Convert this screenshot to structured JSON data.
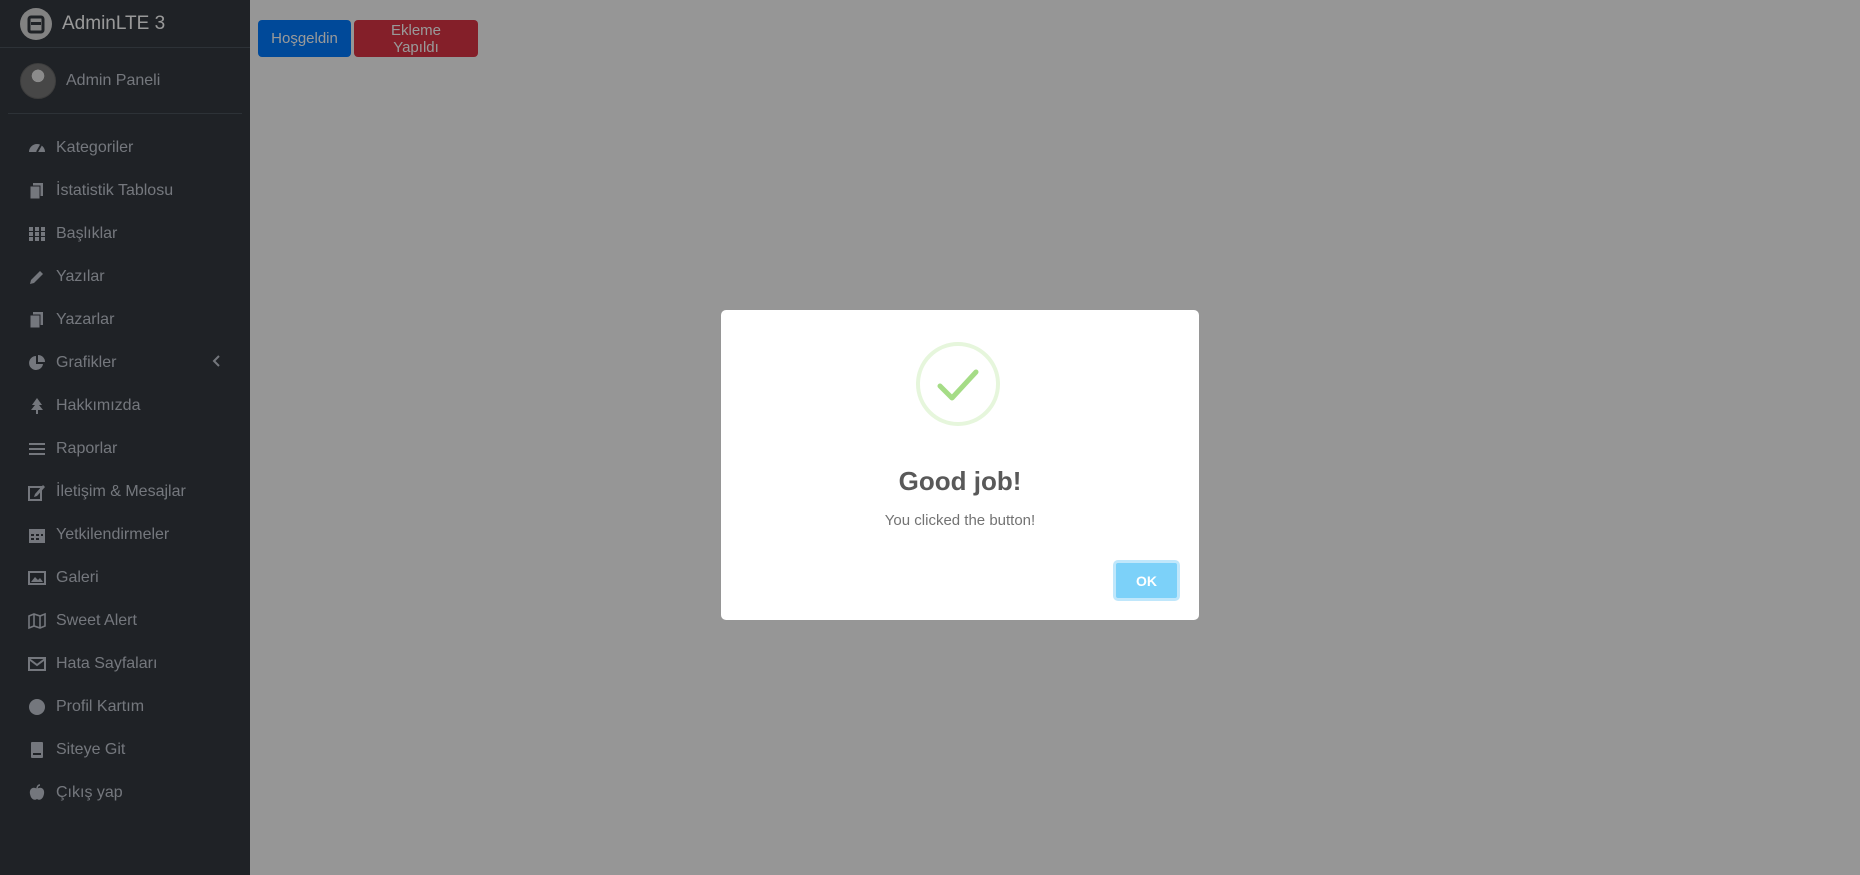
{
  "brand": {
    "title": "AdminLTE 3"
  },
  "user_panel": {
    "name": "Admin Paneli"
  },
  "sidebar": {
    "items": [
      {
        "label": "Kategoriler",
        "icon": "tachometer-icon"
      },
      {
        "label": "İstatistik Tablosu",
        "icon": "copy-icon"
      },
      {
        "label": "Başlıklar",
        "icon": "grid-icon"
      },
      {
        "label": "Yazılar",
        "icon": "pencil-icon"
      },
      {
        "label": "Yazarlar",
        "icon": "copy-icon"
      },
      {
        "label": "Grafikler",
        "icon": "pie-chart-icon"
      },
      {
        "label": "Hakkımızda",
        "icon": "tree-icon"
      },
      {
        "label": "Raporlar",
        "icon": "bars-icon"
      },
      {
        "label": "İletişim & Mesajlar",
        "icon": "edit-icon"
      },
      {
        "label": "Yetkilendirmeler",
        "icon": "calendar-icon"
      },
      {
        "label": "Galeri",
        "icon": "image-icon"
      },
      {
        "label": "Sweet Alert",
        "icon": "map-icon"
      },
      {
        "label": "Hata Sayfaları",
        "icon": "envelope-icon"
      },
      {
        "label": "Profil Kartım",
        "icon": "circle-icon"
      },
      {
        "label": "Siteye Git",
        "icon": "book-icon"
      },
      {
        "label": "Çıkış yap",
        "icon": "apple-icon"
      }
    ]
  },
  "toolbar": {
    "welcome_label": "Hoşgeldin",
    "added_label": "Ekleme Yapıldı"
  },
  "alert": {
    "title": "Good job!",
    "text": "You clicked the button!",
    "ok_label": "OK",
    "icon": "check-icon"
  },
  "colors": {
    "sidebar_bg": "#343a40",
    "primary": "#007bff",
    "danger": "#dc3545",
    "success_check": "#a5dc86",
    "ok_button": "#7cd1f9"
  }
}
